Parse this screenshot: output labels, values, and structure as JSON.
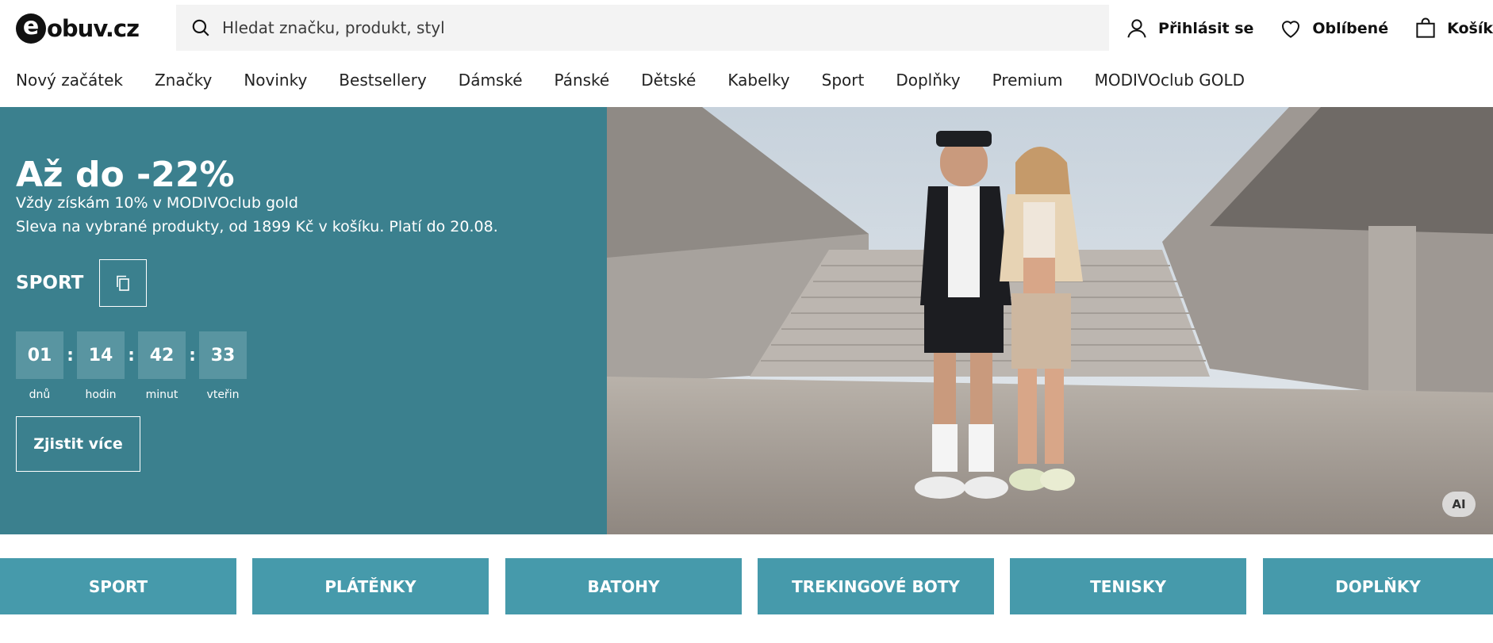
{
  "brand": {
    "logo_letter": "e",
    "logo_text": "obuv.cz"
  },
  "search": {
    "placeholder": "Hledat značku, produkt, styl"
  },
  "header_actions": {
    "login": "Přihlásit se",
    "favorites": "Oblíbené",
    "cart": "Košík"
  },
  "nav": {
    "items": [
      "Nový začátek",
      "Značky",
      "Novinky",
      "Bestsellery",
      "Dámské",
      "Pánské",
      "Dětské",
      "Kabelky",
      "Sport",
      "Doplňky",
      "Premium",
      "MODIVOclub GOLD"
    ]
  },
  "hero": {
    "title": "Až do -22%",
    "line1": "Vždy získám 10% v MODIVOclub gold",
    "line2": "Sleva na vybrané produkty, od 1899 Kč v košíku. Platí do 20.08.",
    "code": "SPORT",
    "countdown": {
      "days": "01",
      "days_label": "dnů",
      "hours": "14",
      "hours_label": "hodin",
      "minutes": "42",
      "minutes_label": "minut",
      "seconds": "33",
      "seconds_label": "vteřin",
      "separator": ":"
    },
    "cta": "Zjistit více",
    "ai_badge": "AI",
    "bg_color": "#3b808e"
  },
  "categories": [
    "SPORT",
    "PLÁTĚNKY",
    "BATOHY",
    "TREKINGOVÉ BOTY",
    "TENISKY",
    "DOPLŇKY"
  ],
  "colors": {
    "category_bg": "#469aab",
    "countdown_box": "#5995a1"
  }
}
